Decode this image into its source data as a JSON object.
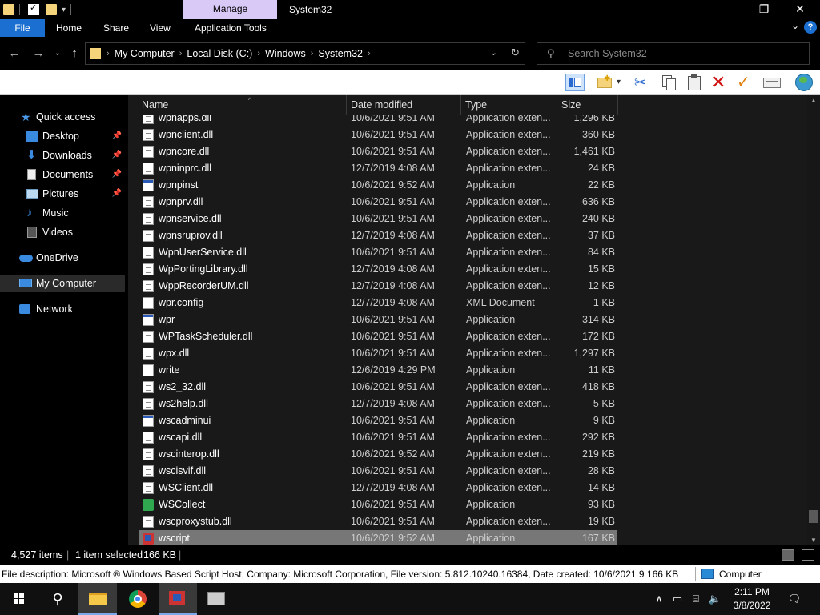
{
  "window": {
    "title": "System32",
    "context_tab": "Manage",
    "minimize": "—",
    "maximize": "❐",
    "close": "✕"
  },
  "ribbon": {
    "tabs": [
      "File",
      "Home",
      "Share",
      "View",
      "Application Tools"
    ],
    "help": "?",
    "collapse": "⌄"
  },
  "address": {
    "crumbs": [
      "My Computer",
      "Local Disk (C:)",
      "Windows",
      "System32"
    ],
    "separator": "›",
    "search_placeholder": "Search System32"
  },
  "nav_pane": {
    "items": [
      {
        "label": "Quick access",
        "icon": "star-icon"
      },
      {
        "label": "Desktop",
        "icon": "desktop-icon",
        "pinned": true
      },
      {
        "label": "Downloads",
        "icon": "download-icon",
        "pinned": true
      },
      {
        "label": "Documents",
        "icon": "document-icon",
        "pinned": true
      },
      {
        "label": "Pictures",
        "icon": "picture-icon",
        "pinned": true
      },
      {
        "label": "Music",
        "icon": "music-icon"
      },
      {
        "label": "Videos",
        "icon": "video-icon"
      },
      {
        "label": "OneDrive",
        "icon": "cloud-icon"
      },
      {
        "label": "My Computer",
        "icon": "computer-icon"
      },
      {
        "label": "Network",
        "icon": "network-icon"
      }
    ]
  },
  "columns": {
    "name": "Name",
    "date": "Date modified",
    "type": "Type",
    "size": "Size"
  },
  "files": [
    {
      "name": "wpnapps.dll",
      "date": "10/6/2021 9:51 AM",
      "type": "Application exten...",
      "size": "1,296 KB",
      "kind": "dll"
    },
    {
      "name": "wpnclient.dll",
      "date": "10/6/2021 9:51 AM",
      "type": "Application exten...",
      "size": "360 KB",
      "kind": "dll"
    },
    {
      "name": "wpncore.dll",
      "date": "10/6/2021 9:51 AM",
      "type": "Application exten...",
      "size": "1,461 KB",
      "kind": "dll"
    },
    {
      "name": "wpninprc.dll",
      "date": "12/7/2019 4:08 AM",
      "type": "Application exten...",
      "size": "24 KB",
      "kind": "dll"
    },
    {
      "name": "wpnpinst",
      "date": "10/6/2021 9:52 AM",
      "type": "Application",
      "size": "22 KB",
      "kind": "app"
    },
    {
      "name": "wpnprv.dll",
      "date": "10/6/2021 9:51 AM",
      "type": "Application exten...",
      "size": "636 KB",
      "kind": "dll"
    },
    {
      "name": "wpnservice.dll",
      "date": "10/6/2021 9:51 AM",
      "type": "Application exten...",
      "size": "240 KB",
      "kind": "dll"
    },
    {
      "name": "wpnsruprov.dll",
      "date": "12/7/2019 4:08 AM",
      "type": "Application exten...",
      "size": "37 KB",
      "kind": "dll"
    },
    {
      "name": "WpnUserService.dll",
      "date": "10/6/2021 9:51 AM",
      "type": "Application exten...",
      "size": "84 KB",
      "kind": "dll"
    },
    {
      "name": "WpPortingLibrary.dll",
      "date": "12/7/2019 4:08 AM",
      "type": "Application exten...",
      "size": "15 KB",
      "kind": "dll"
    },
    {
      "name": "WppRecorderUM.dll",
      "date": "12/7/2019 4:08 AM",
      "type": "Application exten...",
      "size": "12 KB",
      "kind": "dll"
    },
    {
      "name": "wpr.config",
      "date": "12/7/2019 4:08 AM",
      "type": "XML Document",
      "size": "1 KB",
      "kind": "cfg"
    },
    {
      "name": "wpr",
      "date": "10/6/2021 9:51 AM",
      "type": "Application",
      "size": "314 KB",
      "kind": "app"
    },
    {
      "name": "WPTaskScheduler.dll",
      "date": "10/6/2021 9:51 AM",
      "type": "Application exten...",
      "size": "172 KB",
      "kind": "dll"
    },
    {
      "name": "wpx.dll",
      "date": "10/6/2021 9:51 AM",
      "type": "Application exten...",
      "size": "1,297 KB",
      "kind": "dll"
    },
    {
      "name": "write",
      "date": "12/6/2019 4:29 PM",
      "type": "Application",
      "size": "11 KB",
      "kind": "cfg"
    },
    {
      "name": "ws2_32.dll",
      "date": "10/6/2021 9:51 AM",
      "type": "Application exten...",
      "size": "418 KB",
      "kind": "dll"
    },
    {
      "name": "ws2help.dll",
      "date": "12/7/2019 4:08 AM",
      "type": "Application exten...",
      "size": "5 KB",
      "kind": "dll"
    },
    {
      "name": "wscadminui",
      "date": "10/6/2021 9:51 AM",
      "type": "Application",
      "size": "9 KB",
      "kind": "app"
    },
    {
      "name": "wscapi.dll",
      "date": "10/6/2021 9:51 AM",
      "type": "Application exten...",
      "size": "292 KB",
      "kind": "dll"
    },
    {
      "name": "wscinterop.dll",
      "date": "10/6/2021 9:52 AM",
      "type": "Application exten...",
      "size": "219 KB",
      "kind": "dll"
    },
    {
      "name": "wscisvif.dll",
      "date": "10/6/2021 9:51 AM",
      "type": "Application exten...",
      "size": "28 KB",
      "kind": "dll"
    },
    {
      "name": "WSClient.dll",
      "date": "12/7/2019 4:08 AM",
      "type": "Application exten...",
      "size": "14 KB",
      "kind": "dll"
    },
    {
      "name": "WSCollect",
      "date": "10/6/2021 9:51 AM",
      "type": "Application",
      "size": "93 KB",
      "kind": "wsc"
    },
    {
      "name": "wscproxystub.dll",
      "date": "10/6/2021 9:51 AM",
      "type": "Application exten...",
      "size": "19 KB",
      "kind": "dll"
    },
    {
      "name": "wscript",
      "date": "10/6/2021 9:52 AM",
      "type": "Application",
      "size": "167 KB",
      "kind": "script",
      "selected": true
    }
  ],
  "status": {
    "items": "4,527 items",
    "selected": "1 item selected",
    "size": "166 KB",
    "sep": "|"
  },
  "details": {
    "text": "File description: Microsoft ® Windows Based Script Host, Company: Microsoft Corporation, File version: 5.812.10240.16384, Date created: 10/6/2021 9 166 KB",
    "location": "Computer"
  },
  "taskbar": {
    "time": "2:11 PM",
    "date": "3/8/2022"
  },
  "colors": {
    "accent": "#1a6fd1",
    "context_tab": "#d9c9f7",
    "selection": "#777777"
  }
}
